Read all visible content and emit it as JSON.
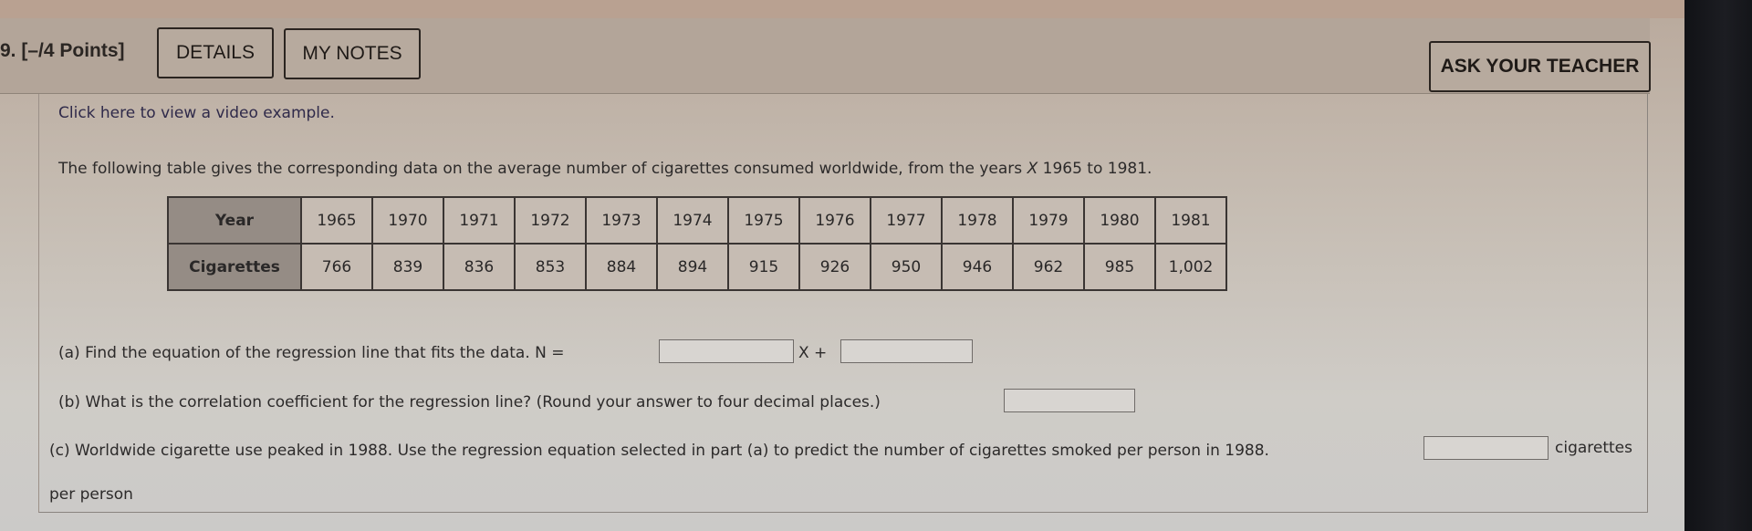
{
  "header": {
    "question_label": "9. [–/4 Points]",
    "details_button": "DETAILS",
    "my_notes_button": "MY NOTES",
    "ask_teacher_button": "ASK YOUR TEACHER"
  },
  "video_link": "Click here to view a video example.",
  "intro_text_prefix": "The following table gives the corresponding data on the average number of cigarettes consumed worldwide, from the years ",
  "intro_var": "X",
  "intro_text_suffix": " 1965 to 1981.",
  "table": {
    "row_headers": [
      "Year",
      "Cigarettes"
    ],
    "years": [
      "1965",
      "1970",
      "1971",
      "1972",
      "1973",
      "1974",
      "1975",
      "1976",
      "1977",
      "1978",
      "1979",
      "1980",
      "1981"
    ],
    "cigarettes": [
      "766",
      "839",
      "836",
      "853",
      "884",
      "894",
      "915",
      "926",
      "950",
      "946",
      "962",
      "985",
      "1,002"
    ]
  },
  "part_a": {
    "text": "(a) Find the equation of the regression line that fits the data. N =",
    "mid_text": "X +",
    "slope_value": "",
    "intercept_value": ""
  },
  "part_b": {
    "text": "(b) What is the correlation coefficient for the regression line? (Round your answer to four decimal places.)",
    "value": ""
  },
  "part_c": {
    "text": "(c) Worldwide cigarette use peaked in 1988. Use the regression equation selected in part (a) to predict the number of cigarettes smoked per person in 1988.",
    "unit_text": "cigarettes",
    "wrap_text": "per person",
    "value": ""
  }
}
